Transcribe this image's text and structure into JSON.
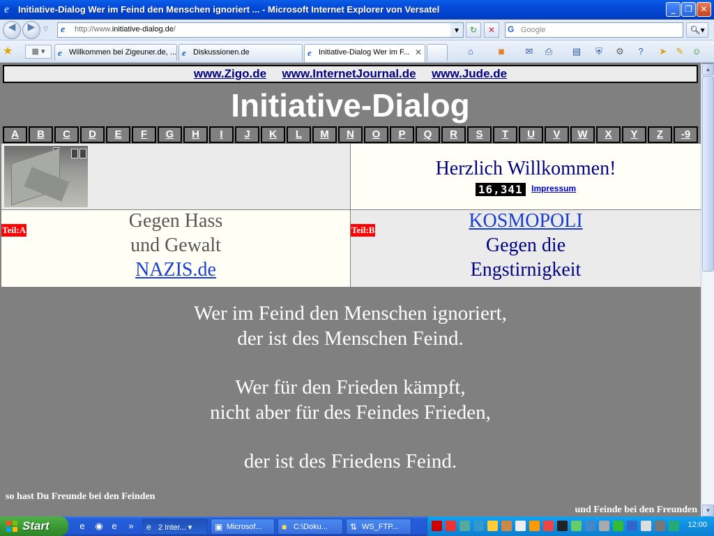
{
  "window": {
    "title": "Initiative-Dialog Wer im Feind den Menschen ignoriert ... - Microsoft Internet Explorer von Versatel"
  },
  "addressbar": {
    "url_prefix": "http://www.",
    "url_domain": "initiative-dialog.de",
    "url_suffix": "/",
    "search_placeholder": "Google"
  },
  "tabs": [
    {
      "label": "Willkommen bei Zigeuner.de, ..."
    },
    {
      "label": "Diskussionen.de"
    },
    {
      "label": "Initiative-Dialog Wer im F..."
    }
  ],
  "site": {
    "top_links": [
      "www.Zigo.de",
      "www.InternetJournal.de",
      "www.Jude.de"
    ],
    "title": "Initiative-Dialog",
    "alphabet": [
      "A",
      "B",
      "C",
      "D",
      "E",
      "F",
      "G",
      "H",
      "I",
      "J",
      "K",
      "L",
      "M",
      "N",
      "O",
      "P",
      "Q",
      "R",
      "S",
      "T",
      "U",
      "V",
      "W",
      "X",
      "Y",
      "Z",
      "-9"
    ],
    "welcome": "Herzlich Willkommen!",
    "counter": "16,341",
    "impressum": "Impressum",
    "teil_a": "Teil:A",
    "teil_b": "Teil:B",
    "left_line1": "Gegen Hass",
    "left_line2": "und Gewalt",
    "left_link": "NAZIS.de",
    "right_link": "KOSMOPOLI",
    "right_line1": "Gegen die",
    "right_line2": "Engstirnigkeit",
    "quote": {
      "l1": "Wer im Feind den Menschen ignoriert,",
      "l2": "der ist des Menschen Feind.",
      "l3": "Wer für den Frieden kämpft,",
      "l4": "nicht aber für des Feindes Frieden,",
      "l5": "der ist des Friedens Feind."
    },
    "motto_left": "so hast Du Freunde bei den Feinden",
    "motto_right": "und Feinde bei den Freunden"
  },
  "taskbar": {
    "start": "Start",
    "tasks": [
      {
        "label": "2 Inter..."
      },
      {
        "label": "Microsof..."
      },
      {
        "label": "C:\\Doku..."
      },
      {
        "label": "WS_FTP..."
      }
    ],
    "clock": "12:00"
  }
}
